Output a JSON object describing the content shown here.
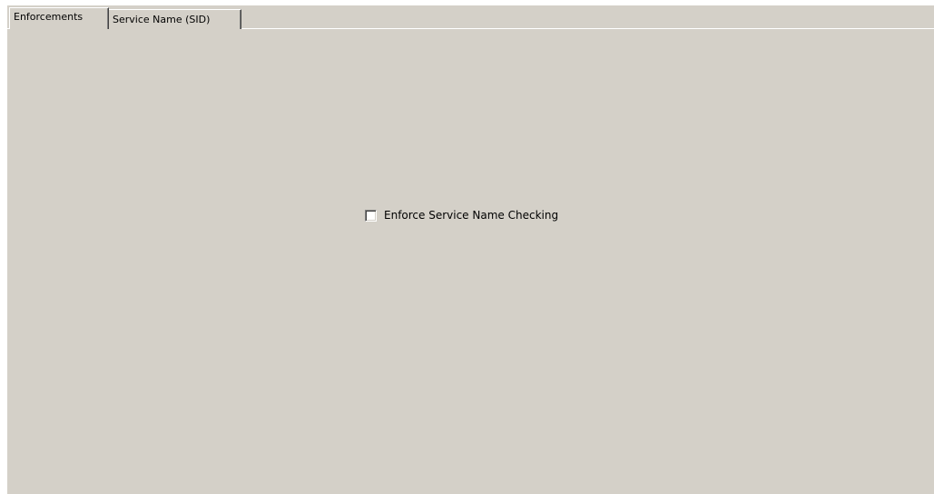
{
  "tabs": [
    {
      "label": "Enforcements",
      "selected": true
    },
    {
      "label": "Service Name (SID)",
      "selected": false
    }
  ],
  "enforcements": {
    "enforce_service_name_checking": {
      "label": "Enforce Service Name Checking",
      "checked": false
    }
  },
  "colors": {
    "panel_background": "#d4d0c8",
    "page_background": "#ffffff"
  }
}
